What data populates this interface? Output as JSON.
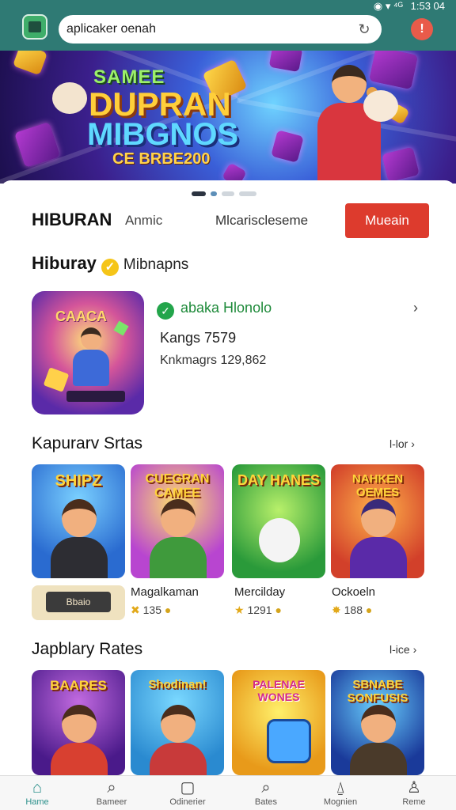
{
  "status_bar": {
    "icons": "◉ ▾ ⁴ᴳ",
    "time": "1:53 04"
  },
  "search": {
    "value": "aplicaker oenah",
    "refresh_icon": "refresh-icon"
  },
  "banner": {
    "line1": "SAMEE",
    "line2": "DUPRAN",
    "line3": "MIBGNOS",
    "sub": "CE BRBE200"
  },
  "tabs": {
    "main": "HIBURAN",
    "sub": "Anmic",
    "middle": "Mlcariscleseme",
    "install": "Mueain"
  },
  "section1": {
    "title": "Hiburay",
    "tag": "Mibnapns"
  },
  "featured": {
    "name": "abaka Hlonolo",
    "line1": "Kangs 7579",
    "line2": "Knkmagrs 129,862",
    "art_text": "CAACA"
  },
  "section2": {
    "title": "Kapurarv Srtas",
    "more": "l-lor"
  },
  "row1": [
    {
      "art": "SHIPZ",
      "name": "",
      "rating": ""
    },
    {
      "art": "CUEGRAN CAMEE",
      "name": "Magalkaman",
      "rating": "135"
    },
    {
      "art": "DAY HANES",
      "name": "Mercilday",
      "rating": "1291"
    },
    {
      "art": "NAHKEN OEMES",
      "name": "Ockoeln",
      "rating": "188"
    }
  ],
  "promo": {
    "label": "Bbaio"
  },
  "section3": {
    "title": "Japblary Rates",
    "more": "l-ice"
  },
  "row2": [
    {
      "art": "BAARES"
    },
    {
      "art": "Shodinan!"
    },
    {
      "art": "PALENAE WONES"
    },
    {
      "art": "SBNABE SONFUSIS"
    }
  ],
  "bottom_nav": [
    {
      "label": "Hame",
      "icon": "home-icon"
    },
    {
      "label": "Bameer",
      "icon": "search-icon"
    },
    {
      "label": "Odinerier",
      "icon": "app-icon"
    },
    {
      "label": "Bates",
      "icon": "search-icon"
    },
    {
      "label": "Mognien",
      "icon": "bell-icon"
    },
    {
      "label": "Reme",
      "icon": "person-icon"
    }
  ],
  "colors": {
    "header": "#2f7a74",
    "install_button": "#dd3b2d",
    "nav_active": "#2a8f8a"
  }
}
